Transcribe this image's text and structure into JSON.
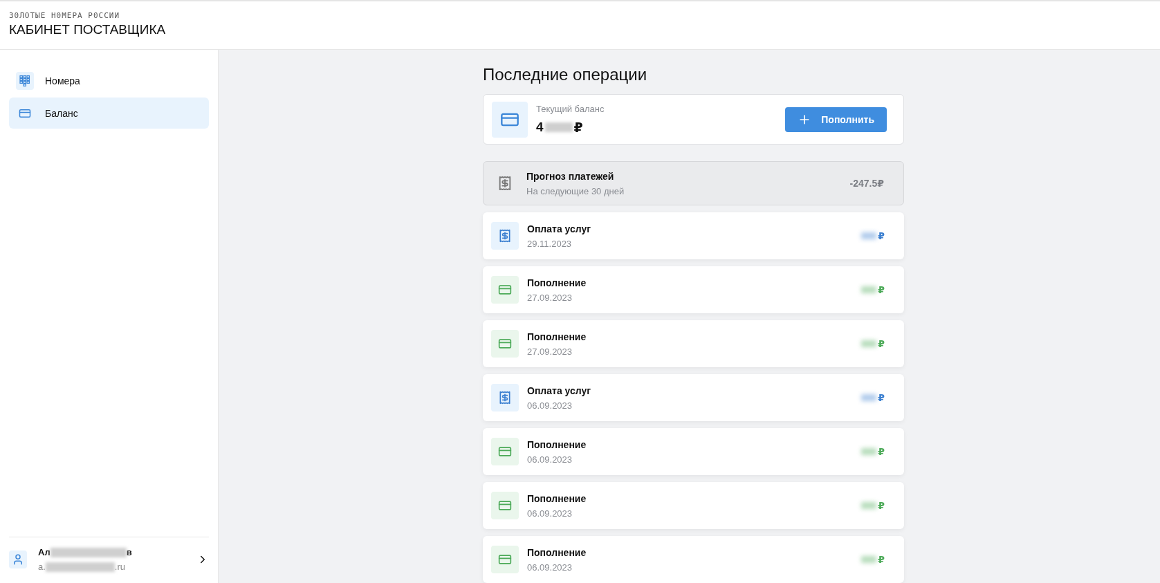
{
  "header": {
    "logo": "З0ЛОТЫЕ Н0МЕРА Р0ССИИ",
    "title": "КАБИНЕТ ПОСТАВЩИКА"
  },
  "sidebar": {
    "items": [
      {
        "label": "Номера",
        "kind": "numbers",
        "selected": false
      },
      {
        "label": "Баланс",
        "kind": "balance",
        "selected": true
      }
    ],
    "user": {
      "name_start": "Ал",
      "name_end": "в",
      "email_start": "a.",
      "email_end": ".ru"
    }
  },
  "page_title": "Последние операции",
  "balance": {
    "label": "Текущий баланс",
    "amount_start": "4",
    "currency": "₽",
    "button": "Пополнить"
  },
  "forecast": {
    "title": "Прогноз платежей",
    "subtitle": "На следующие 30 дней",
    "amount": "-247.5₽"
  },
  "operations": [
    {
      "kind": "payment",
      "title": "Оплата услуг",
      "date": "29.11.2023",
      "currency": "₽"
    },
    {
      "kind": "topup",
      "title": "Пополнение",
      "date": "27.09.2023",
      "currency": "₽"
    },
    {
      "kind": "topup",
      "title": "Пополнение",
      "date": "27.09.2023",
      "currency": "₽"
    },
    {
      "kind": "payment",
      "title": "Оплата услуг",
      "date": "06.09.2023",
      "currency": "₽"
    },
    {
      "kind": "topup",
      "title": "Пополнение",
      "date": "06.09.2023",
      "currency": "₽"
    },
    {
      "kind": "topup",
      "title": "Пополнение",
      "date": "06.09.2023",
      "currency": "₽"
    },
    {
      "kind": "topup",
      "title": "Пополнение",
      "date": "06.09.2023",
      "currency": "₽"
    }
  ]
}
